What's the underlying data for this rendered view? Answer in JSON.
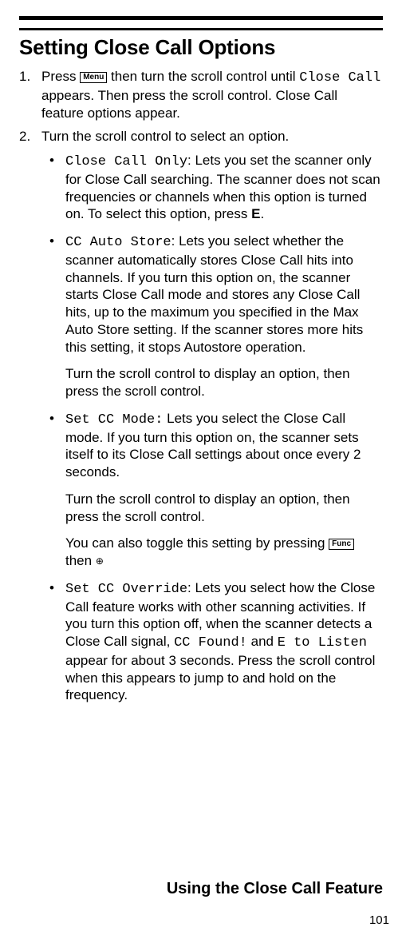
{
  "heading": "Setting Close Call Options",
  "menu_label": "Menu",
  "func_label": "Func",
  "step1": {
    "num": "1.",
    "pre": "Press ",
    "mid": " then turn the scroll control until ",
    "code": "Close Call",
    "post": " appears. Then press the scroll control. Close Call feature options appear."
  },
  "step2": {
    "num": "2.",
    "text": "Turn the scroll control to select an option."
  },
  "bullets": {
    "b1": {
      "code": "Close Call Only",
      "text": ": Lets you set the scanner only for Close Call searching. The scanner does not scan frequencies or channels when this option is turned on. To select this option, press ",
      "bold_e": "E",
      "after": "."
    },
    "b2": {
      "code": "CC Auto Store",
      "text": ": Lets you select whether the scanner automatically stores Close Call hits into channels. If you turn this option on, the scanner starts Close Call mode and stores any Close Call hits, up to the maximum you specified in the Max Auto Store setting. If the scanner stores more hits this setting, it stops Autostore operation."
    },
    "sub2": "Turn the scroll control to display an option, then press the scroll control.",
    "b3": {
      "code": "Set CC Mode:",
      "text": " Lets you select the Close Call mode. If you turn this option on, the scanner sets itself to its Close Call settings about once every 2 seconds."
    },
    "sub3": "Turn the scroll control to display an option, then press the scroll control.",
    "sub3b": {
      "pre": "You can also toggle this setting by pressing ",
      "mid": " then "
    },
    "b4": {
      "code": "Set CC Override",
      "text1": ": Lets you select how the Close Call feature works with other scanning activities. If you turn this option off, when the scanner detects a Close Call signal, ",
      "code2": "CC Found!",
      "text2": " and ",
      "code3": "E to Listen",
      "text3": " appear for about 3 seconds. Press the scroll control when this appears to jump to and hold on the frequency."
    }
  },
  "footer": "Using the Close Call Feature",
  "page": "101"
}
